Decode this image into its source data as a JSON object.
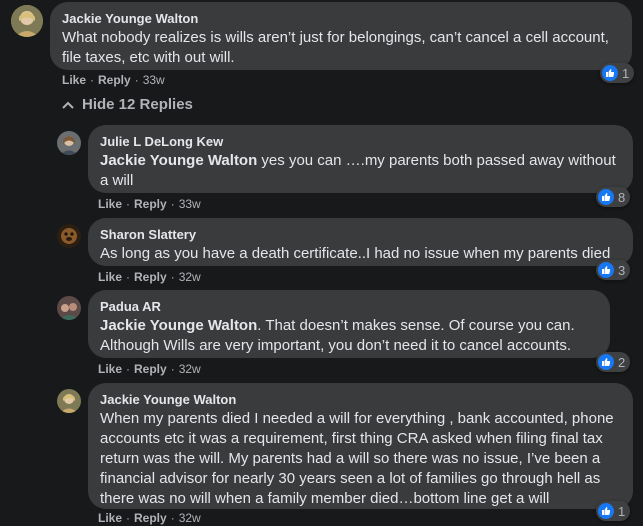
{
  "colors": {
    "background": "#18191a",
    "bubble": "#3a3b3c",
    "text": "#e4e6eb",
    "secondary": "#b0b3b8",
    "like_blue": "#1877f2"
  },
  "comments": [
    {
      "author": "Jackie Younge Walton",
      "text": "What nobody realizes is wills aren’t just for belongings, can’t cancel a cell account, file taxes, etc with out will.",
      "like": "Like",
      "reply": "Reply",
      "time": "33w",
      "reactions": "1"
    }
  ],
  "hide_replies_label": "Hide 12 Replies",
  "replies": [
    {
      "author": "Julie L DeLong Kew",
      "mention": "Jackie Younge Walton",
      "text": " yes you can ….my parents both passed away without a will",
      "like": "Like",
      "reply": "Reply",
      "time": "33w",
      "reactions": "8"
    },
    {
      "author": "Sharon Slattery",
      "mention": "",
      "text": "As long as you have a death certificate..I had no issue when my parents died",
      "like": "Like",
      "reply": "Reply",
      "time": "32w",
      "reactions": "3"
    },
    {
      "author": "Padua AR",
      "mention": "Jackie Younge Walton",
      "text": ". That doesn’t makes sense. Of course you can. Although Wills are very important, you don’t need it to cancel accounts.",
      "like": "Like",
      "reply": "Reply",
      "time": "32w",
      "reactions": "2"
    },
    {
      "author": "Jackie Younge Walton",
      "mention": "",
      "text": "When my parents died I needed a will for everything , bank accounted, phone accounts etc it was a requirement, first thing CRA asked when filing final tax return was the will. My parents had a will so there was no issue, I’ve been a financial advisor for nearly 30 years seen a lot of families go through hell as there was no will when a family member died…bottom line get a will",
      "like": "Like",
      "reply": "Reply",
      "time": "32w",
      "reactions": "1"
    }
  ],
  "icons": {
    "avatar": "avatar",
    "like": "thumbs-up-icon",
    "collapse": "chevron-up-icon"
  }
}
